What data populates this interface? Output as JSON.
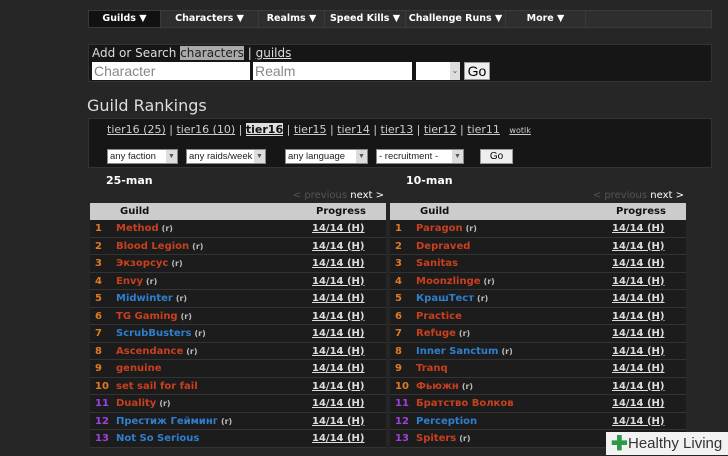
{
  "nav": [
    "Guilds ▼",
    "Characters ▼",
    "Realms ▼",
    "Speed Kills ▼",
    "Challenge Runs ▼",
    "More ▼"
  ],
  "search": {
    "prefix": "Add or Search",
    "characters": "characters",
    "sep": "|",
    "guilds": "guilds",
    "character_placeholder": "Character",
    "realm_placeholder": "Realm",
    "go": "Go"
  },
  "title": "Guild Rankings",
  "tiers": [
    "tier16 (25)",
    "tier16 (10)",
    "tier16",
    "tier15",
    "tier14",
    "tier13",
    "tier12",
    "tier11"
  ],
  "wotlk": "wotlk",
  "filters": [
    "any faction",
    "any raids/week",
    "any language",
    "- recruitment -"
  ],
  "filter_go": "Go",
  "colors": {
    "horde": "#c8401e",
    "alliance": "#2f7fcf",
    "rank_orange": "#e07a22",
    "rank_purple": "#a040e0"
  },
  "panels": [
    {
      "title": "25-man",
      "prev": "< previous",
      "next": "next >",
      "col_guild": "Guild",
      "col_progress": "Progress",
      "rows": [
        {
          "rank": "1",
          "name": "Method",
          "r": "(r)",
          "f": "h",
          "progress": "14/14 (H)"
        },
        {
          "rank": "2",
          "name": "Blood Legion",
          "r": "(r)",
          "f": "h",
          "progress": "14/14 (H)"
        },
        {
          "rank": "3",
          "name": "Экзорсус",
          "r": "(r)",
          "f": "h",
          "progress": "14/14 (H)"
        },
        {
          "rank": "4",
          "name": "Envy",
          "r": "(r)",
          "f": "h",
          "progress": "14/14 (H)"
        },
        {
          "rank": "5",
          "name": "Midwinter",
          "r": "(r)",
          "f": "a",
          "progress": "14/14 (H)"
        },
        {
          "rank": "6",
          "name": "TG Gaming",
          "r": "(r)",
          "f": "h",
          "progress": "14/14 (H)"
        },
        {
          "rank": "7",
          "name": "ScrubBusters",
          "r": "(r)",
          "f": "a",
          "progress": "14/14 (H)"
        },
        {
          "rank": "8",
          "name": "Ascendance",
          "r": "(r)",
          "f": "h",
          "progress": "14/14 (H)"
        },
        {
          "rank": "9",
          "name": "genuine",
          "r": "",
          "f": "h",
          "progress": "14/14 (H)"
        },
        {
          "rank": "10",
          "name": "set sail for fail",
          "r": "",
          "f": "h",
          "progress": "14/14 (H)"
        },
        {
          "rank": "11",
          "name": "Duality",
          "r": "(r)",
          "f": "h",
          "progress": "14/14 (H)"
        },
        {
          "rank": "12",
          "name": "Престиж Гейминг",
          "r": "(r)",
          "f": "a",
          "progress": "14/14 (H)"
        },
        {
          "rank": "13",
          "name": "Not So Serious",
          "r": "",
          "f": "a",
          "progress": "14/14 (H)"
        }
      ]
    },
    {
      "title": "10-man",
      "prev": "< previous",
      "next": "next >",
      "col_guild": "Guild",
      "col_progress": "Progress",
      "rows": [
        {
          "rank": "1",
          "name": "Paragon",
          "r": "(r)",
          "f": "h",
          "progress": "14/14 (H)"
        },
        {
          "rank": "2",
          "name": "Depraved",
          "r": "",
          "f": "h",
          "progress": "14/14 (H)"
        },
        {
          "rank": "3",
          "name": "Sanitas",
          "r": "",
          "f": "h",
          "progress": "14/14 (H)"
        },
        {
          "rank": "4",
          "name": "Moonzlinge",
          "r": "(r)",
          "f": "h",
          "progress": "14/14 (H)"
        },
        {
          "rank": "5",
          "name": "КрашТест",
          "r": "(r)",
          "f": "a",
          "progress": "14/14 (H)"
        },
        {
          "rank": "6",
          "name": "Practice",
          "r": "",
          "f": "h",
          "progress": "14/14 (H)"
        },
        {
          "rank": "7",
          "name": "Refuge",
          "r": "(r)",
          "f": "h",
          "progress": "14/14 (H)"
        },
        {
          "rank": "8",
          "name": "Inner Sanctum",
          "r": "(r)",
          "f": "a",
          "progress": "14/14 (H)"
        },
        {
          "rank": "9",
          "name": "Tranq",
          "r": "",
          "f": "h",
          "progress": "14/14 (H)"
        },
        {
          "rank": "10",
          "name": "Фьюжн",
          "r": "(r)",
          "f": "h",
          "progress": "14/14 (H)"
        },
        {
          "rank": "11",
          "name": "Братство Волков",
          "r": "",
          "f": "h",
          "progress": "14/14 (H)"
        },
        {
          "rank": "12",
          "name": "Perception",
          "r": "",
          "f": "a",
          "progress": "14/14 (H)"
        },
        {
          "rank": "13",
          "name": "Spiters",
          "r": "(r)",
          "f": "h",
          "progress": "14/14 (H)"
        }
      ]
    }
  ],
  "watermark": "Healthy Living"
}
